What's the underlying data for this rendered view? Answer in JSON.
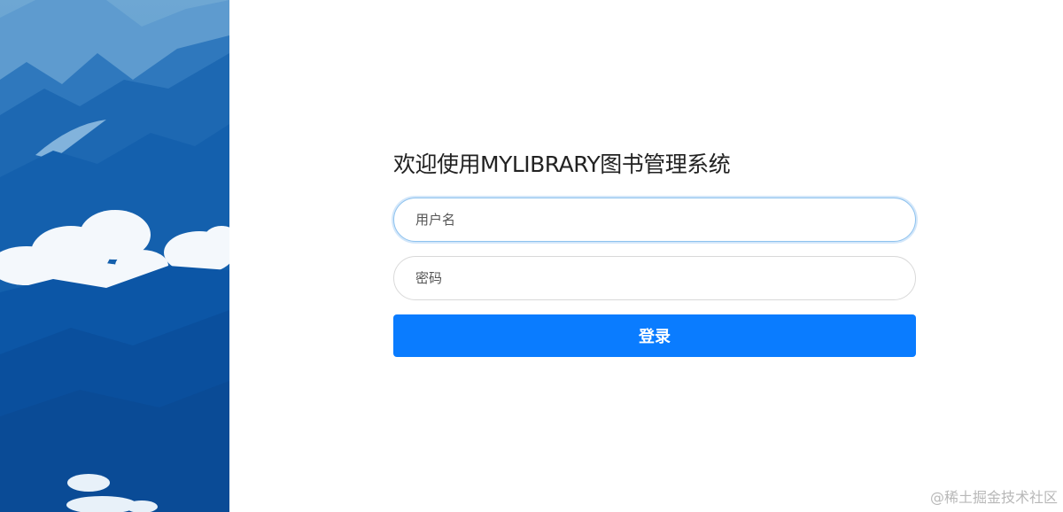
{
  "form": {
    "title": "欢迎使用MYLIBRARY图书管理系统",
    "username_placeholder": "用户名",
    "password_placeholder": "密码",
    "login_label": "登录"
  },
  "watermark": "@稀土掘金技术社区",
  "colors": {
    "primary_button": "#0a7cff",
    "input_border": "#d9d9d9",
    "input_focus_border": "#8ec2ee",
    "side_image_base": "#0a5aa8"
  }
}
